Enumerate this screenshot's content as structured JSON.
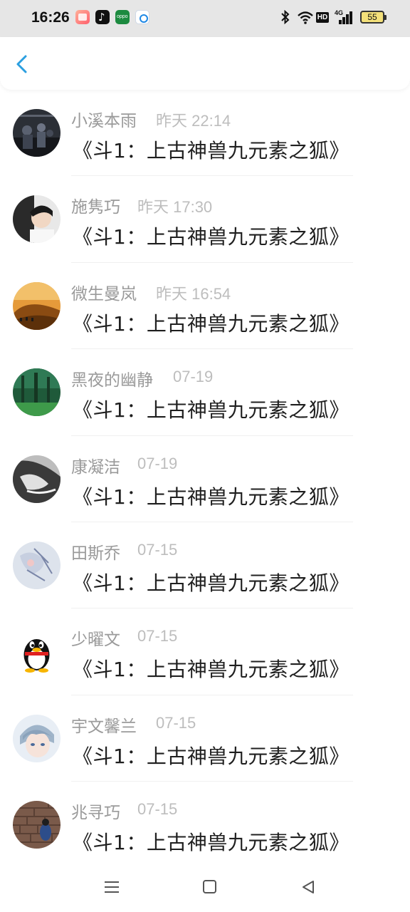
{
  "status_bar": {
    "time": "16:26",
    "app_icons": [
      "gallery-icon",
      "tiktok-icon",
      "oppo-store-icon",
      "browser-icon"
    ],
    "system_icons": [
      "bluetooth-icon",
      "wifi-icon",
      "hd-icon",
      "signal-4g-icon",
      "battery-icon"
    ],
    "hd_label": "HD",
    "network_label": "4G",
    "battery_level": "55"
  },
  "header": {
    "back_icon": "chevron-left-icon",
    "accent_color": "#2b9fe0"
  },
  "messages": [
    {
      "name": "小溪本雨",
      "time": "昨天 22:14",
      "text": "《斗1：上古神兽九元素之狐》",
      "avatar": "concert-photo"
    },
    {
      "name": "施隽巧",
      "time": "昨天 17:30",
      "text": "《斗1：上古神兽九元素之狐》",
      "avatar": "boy-photo"
    },
    {
      "name": "微生曼岚",
      "time": "昨天 16:54",
      "text": "《斗1：上古神兽九元素之狐》",
      "avatar": "desert-camels-photo"
    },
    {
      "name": "黑夜的幽静",
      "time": "07-19",
      "text": "《斗1：上古神兽九元素之狐》",
      "avatar": "forest-photo"
    },
    {
      "name": "康凝洁",
      "time": "07-19",
      "text": "《斗1：上古神兽九元素之狐》",
      "avatar": "bw-portrait-photo"
    },
    {
      "name": "田斯乔",
      "time": "07-15",
      "text": "《斗1：上古神兽九元素之狐》",
      "avatar": "anime-sketch"
    },
    {
      "name": "少曜文",
      "time": "07-15",
      "text": "《斗1：上古神兽九元素之狐》",
      "avatar": "qq-penguin-icon"
    },
    {
      "name": "宇文馨兰",
      "time": "07-15",
      "text": "《斗1：上古神兽九元素之狐》",
      "avatar": "anime-boy"
    },
    {
      "name": "兆寻巧",
      "time": "07-15",
      "text": "《斗1：上古神兽九元素之狐》",
      "avatar": "brick-wall-photo"
    }
  ],
  "nav_bar": {
    "icons": [
      "menu-icon",
      "home-icon",
      "back-triangle-icon"
    ]
  }
}
